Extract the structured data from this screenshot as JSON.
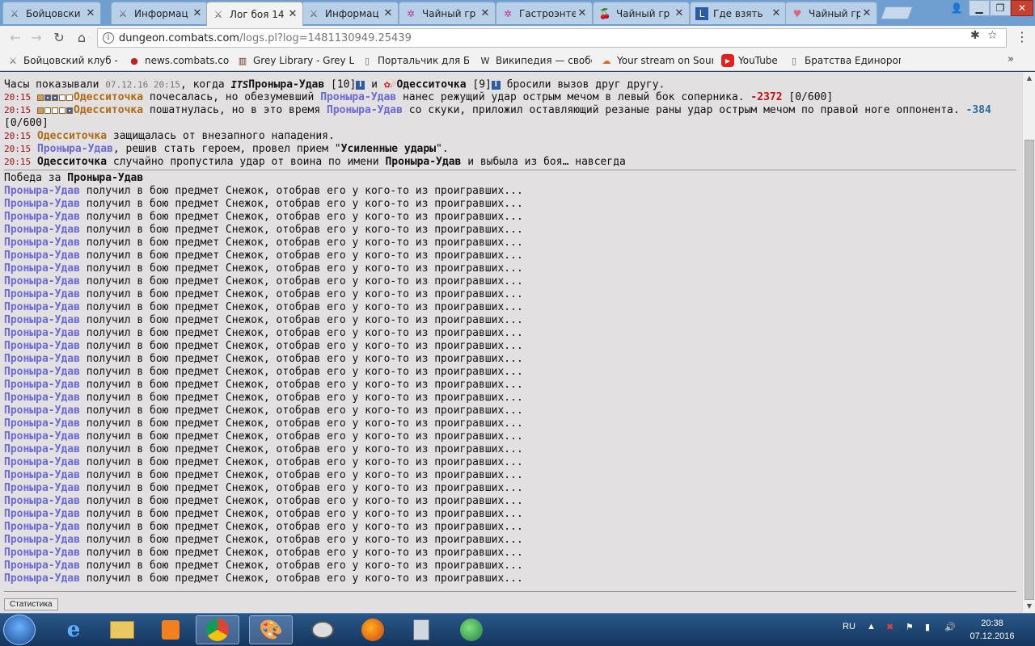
{
  "browser": {
    "tabs": [
      {
        "label": "Бойцовски",
        "icon": "swords-icon",
        "active": false
      },
      {
        "label": "Информац",
        "icon": "swords-icon",
        "active": false
      },
      {
        "label": "Лог боя 14",
        "icon": "swords-icon",
        "active": true
      },
      {
        "label": "Информац",
        "icon": "swords-icon",
        "active": false
      },
      {
        "label": "Чайный гр",
        "icon": "pinwheel-icon",
        "active": false
      },
      {
        "label": "Гастроэнте",
        "icon": "pinwheel-icon",
        "active": false
      },
      {
        "label": "Чайный гр",
        "icon": "cherry-icon",
        "active": false
      },
      {
        "label": "Где взять",
        "icon": "l-icon",
        "active": false
      },
      {
        "label": "Чайный гр",
        "icon": "heart-icon",
        "active": false
      }
    ],
    "url_host": "dungeon.combats.com",
    "url_path": "/logs.pl?log=1481130949.25439",
    "bookmarks": [
      {
        "label": "Бойцовский клуб - о",
        "icon": "swords-icon"
      },
      {
        "label": "news.combats.com",
        "icon": "news-icon"
      },
      {
        "label": "Grey Library - Grey Lil",
        "icon": "library-icon"
      },
      {
        "label": "Портальчик для БКш",
        "icon": "page-icon"
      },
      {
        "label": "Википедия — свобод",
        "icon": "wikipedia-icon"
      },
      {
        "label": "Your stream on Sound",
        "icon": "soundcloud-icon"
      },
      {
        "label": "YouTube",
        "icon": "youtube-icon"
      },
      {
        "label": "Братства Единорога!",
        "icon": "page-icon"
      }
    ]
  },
  "log": {
    "intro_pre": "Часы показывали",
    "intro_date": "07.12.16 20:15",
    "intro_when": ", когда",
    "clan": "ITS",
    "player1": "Проныра-Удав",
    "player1_level": "[10]",
    "and": "и",
    "player2": "Одесситочка",
    "player2_level": "[9]",
    "intro_post": "бросили вызов друг другу.",
    "info_glyph": "i",
    "entries": [
      {
        "time": "20:15",
        "a": "Одесситочка",
        "b": "почесалась, но обезумевший",
        "c": "Проныра-Удав",
        "d": "нанес режущий удар острым мечом в левый бок соперника.",
        "dmg": "-2372",
        "hp": "[0/600]"
      },
      {
        "time": "20:15",
        "a": "Одесситочка",
        "b": "пошатнулась, но в это время",
        "c": "Проныра-Удав",
        "d": "со скуки, приложил оставляющий резаные раны удар острым мечом по правой ноге оппонента.",
        "dmg": "-384",
        "hp": "[0/600]"
      },
      {
        "time": "20:15",
        "a": "Одесситочка",
        "b": "защищалась от внезапного нападения."
      },
      {
        "time": "20:15",
        "a": "Проныра-Удав",
        "b": ", решив стать героем, провел прием \"",
        "skill": "Усиленные удары",
        "b2": "\"."
      },
      {
        "time": "20:15",
        "a": "Одесситочка",
        "b": "случайно пропустила удар от воина по имени",
        "c": "Проныра-Удав",
        "d": "и выбыла из боя… навсегда"
      }
    ],
    "victory_label": "Победа за",
    "victory_name": "Проныра-Удав",
    "loot_name": "Проныра-Удав",
    "loot_text": "получил в бою предмет Снежок, отобрав его у кого-то из проигравших...",
    "loot_count": 31,
    "stats_button": "Статистика"
  },
  "taskbar": {
    "lang": "RU",
    "time": "20:38",
    "date": "07.12.2016"
  }
}
